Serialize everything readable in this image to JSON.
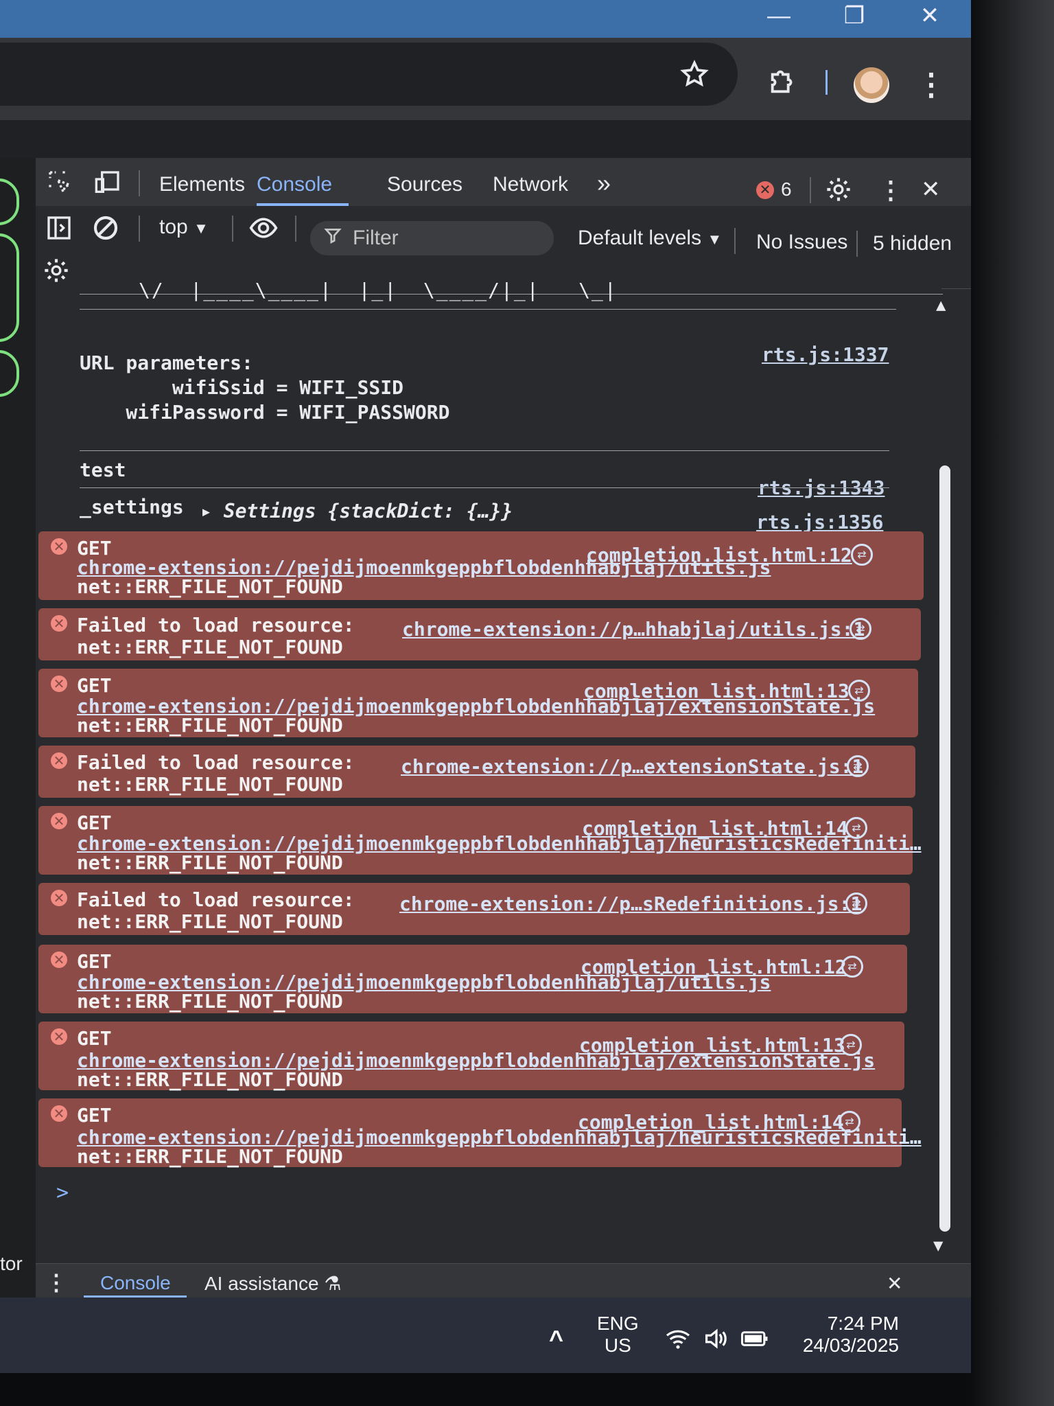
{
  "window": {
    "minimize_glyph": "—",
    "restore_glyph": "❐",
    "close_glyph": "✕"
  },
  "browser": {
    "bookmark_icon": "star-icon",
    "extensions_icon": "puzzle-icon",
    "menu_glyph": "⋮"
  },
  "devtools": {
    "tabs": [
      "Elements",
      "Console",
      "Sources",
      "Network"
    ],
    "more_tabs_glyph": "»",
    "active_tab": "Console",
    "error_count": "6",
    "close_glyph": "✕",
    "toolbar": {
      "context": "top",
      "filter_placeholder": "Filter",
      "levels": "Default levels",
      "issues": "No Issues",
      "hidden": "5 hidden"
    }
  },
  "console": {
    "ascii_art": "\\/  |____\\____|  |_|  \\____/|_|   \\_|",
    "entries": [
      {
        "lines": [
          "URL parameters:",
          "        wifiSsid = WIFI_SSID",
          "    wifiPassword = WIFI_PASSWORD"
        ],
        "source": "rts.js:1337"
      },
      {
        "lines": [
          "test"
        ],
        "source": "rts.js:1343"
      },
      {
        "label": "_settings",
        "object": "▸ Settings {stackDict: {…}}",
        "source": "rts.js:1356"
      }
    ],
    "errors": [
      {
        "type": "GET",
        "url": "chrome-extension://pejdijmoenmkgeppbflobdenhhabjlaj/utils.js",
        "detail": "net::ERR_FILE_NOT_FOUND",
        "source": "completion_list.html:12"
      },
      {
        "type": "Failed to load resource:",
        "detail": "net::ERR_FILE_NOT_FOUND",
        "source": "chrome-extension://p…hhabjlaj/utils.js:1"
      },
      {
        "type": "GET",
        "url": "chrome-extension://pejdijmoenmkgeppbflobdenhhabjlaj/extensionState.js",
        "detail": "net::ERR_FILE_NOT_FOUND",
        "source": "completion_list.html:13"
      },
      {
        "type": "Failed to load resource:",
        "detail": "net::ERR_FILE_NOT_FOUND",
        "source": "chrome-extension://p…extensionState.js:1"
      },
      {
        "type": "GET",
        "url": "chrome-extension://pejdijmoenmkgeppbflobdenhhabjlaj/heuristicsRedefiniti…",
        "detail": "net::ERR_FILE_NOT_FOUND",
        "source": "completion_list.html:14"
      },
      {
        "type": "Failed to load resource:",
        "detail": "net::ERR_FILE_NOT_FOUND",
        "source": "chrome-extension://p…sRedefinitions.js:1"
      },
      {
        "type": "GET",
        "url": "chrome-extension://pejdijmoenmkgeppbflobdenhhabjlaj/utils.js",
        "detail": "net::ERR_FILE_NOT_FOUND",
        "source": "completion_list.html:12"
      },
      {
        "type": "GET",
        "url": "chrome-extension://pejdijmoenmkgeppbflobdenhhabjlaj/extensionState.js",
        "detail": "net::ERR_FILE_NOT_FOUND",
        "source": "completion_list.html:13"
      },
      {
        "type": "GET",
        "url": "chrome-extension://pejdijmoenmkgeppbflobdenhhabjlaj/heuristicsRedefiniti…",
        "detail": "net::ERR_FILE_NOT_FOUND",
        "source": "completion_list.html:14"
      }
    ],
    "prompt_glyph": ">"
  },
  "drawer": {
    "menu_glyph": "⋮",
    "tabs": [
      "Console",
      "AI assistance"
    ],
    "close_glyph": "✕"
  },
  "page_fragment": "tor",
  "taskbar": {
    "chevron_glyph": "^",
    "lang_line1": "ENG",
    "lang_line2": "US",
    "time": "7:24 PM",
    "date": "24/03/2025"
  },
  "colors": {
    "error_row": "#8c4b47",
    "accent": "#8ab4f8",
    "error_badge": "#e46962"
  }
}
